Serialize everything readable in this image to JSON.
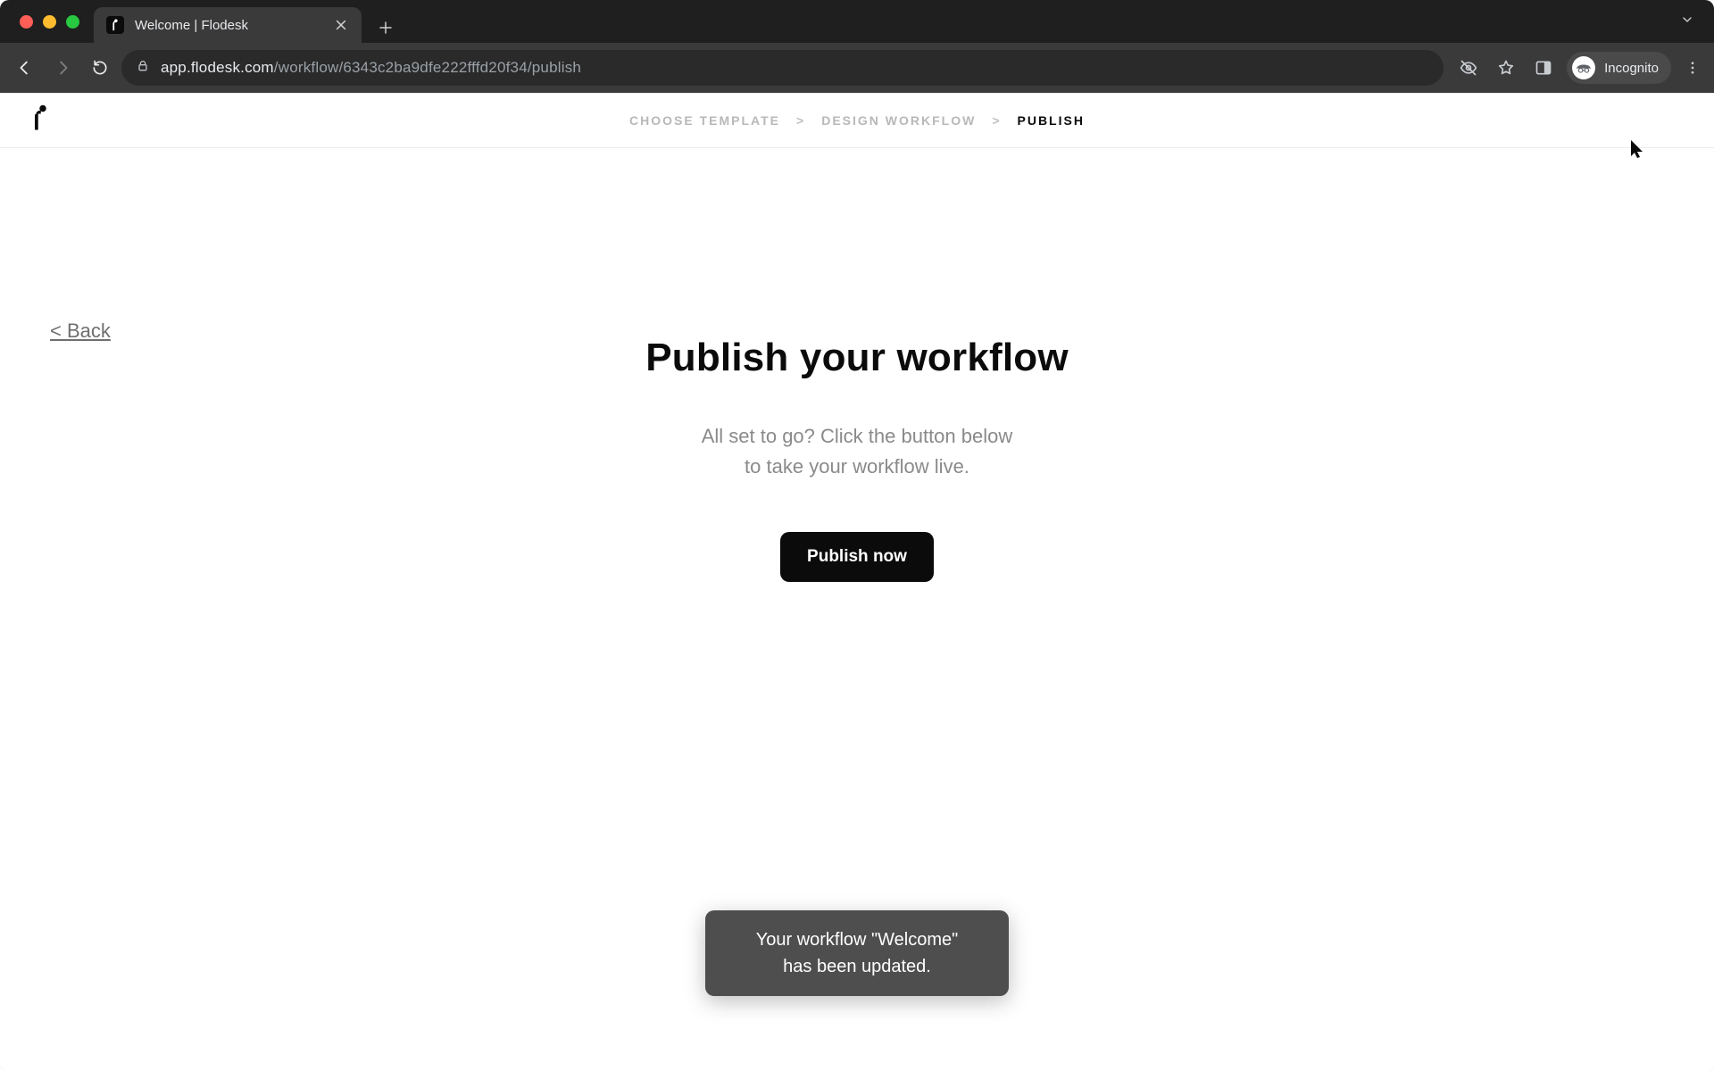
{
  "browser": {
    "tab_title": "Welcome | Flodesk",
    "url_host": "app.flodesk.com",
    "url_path": "/workflow/6343c2ba9dfe222fffd20f34/publish",
    "incognito_label": "Incognito"
  },
  "header": {
    "steps": [
      "CHOOSE TEMPLATE",
      "DESIGN WORKFLOW",
      "PUBLISH"
    ],
    "active_index": 2
  },
  "back": {
    "label": "< Back"
  },
  "main": {
    "headline": "Publish your workflow",
    "subline_1": "All set to go? Click the button below",
    "subline_2": "to take your workflow live.",
    "cta_label": "Publish now"
  },
  "toast": {
    "line_1": "Your workflow \"Welcome\"",
    "line_2": "has been updated."
  },
  "colors": {
    "accent": "#0b0b0b",
    "muted_text": "#8a8a8a",
    "header_border": "#ececec",
    "toast_bg": "#4e4e4e"
  }
}
